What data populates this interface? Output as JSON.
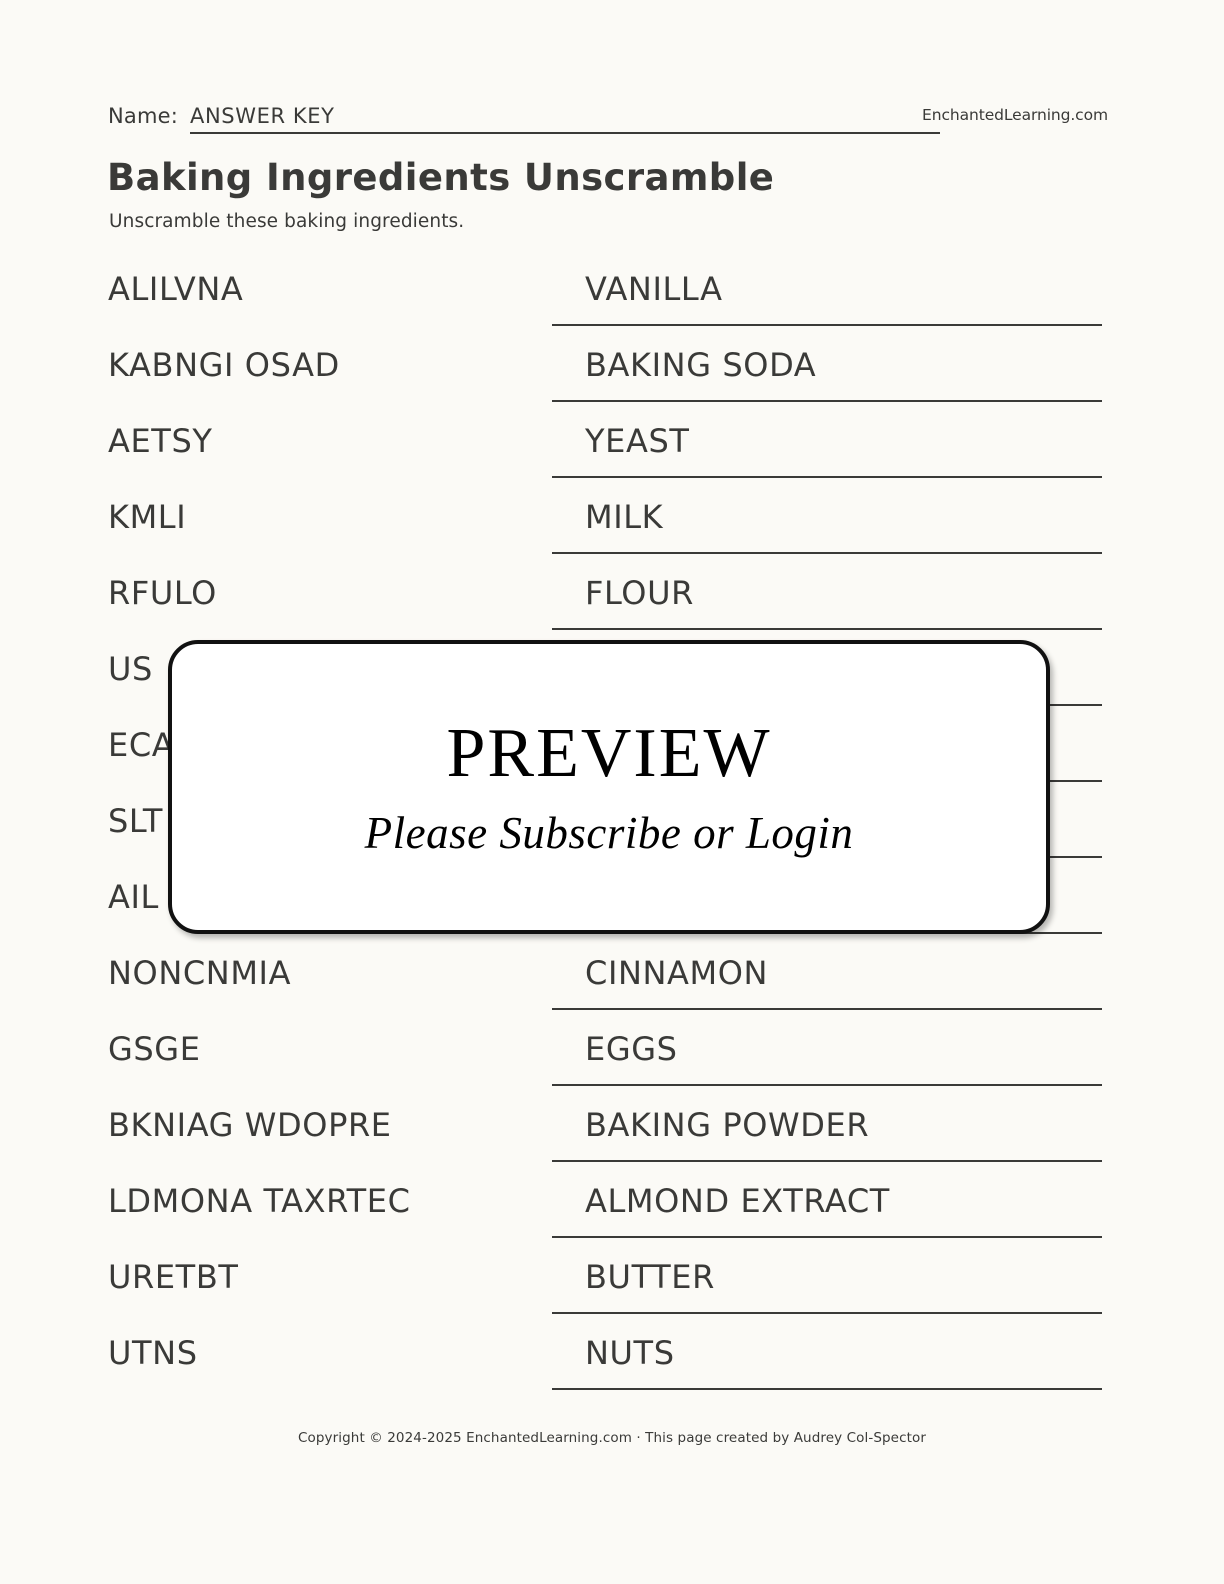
{
  "page": {
    "background_color": "#fbfaf6",
    "text_color": "#3a3a38"
  },
  "header": {
    "name_label": "Name:",
    "name_value": "ANSWER KEY",
    "site_logo": "EnchantedLearning.com"
  },
  "title": "Baking Ingredients Unscramble",
  "instructions": "Unscramble these baking ingredients.",
  "rows": [
    {
      "scrambled": "ALILVNA",
      "answer": "VANILLA",
      "occluded": false
    },
    {
      "scrambled": "KABNGI OSAD",
      "answer": "BAKING SODA",
      "occluded": false
    },
    {
      "scrambled": "AETSY",
      "answer": "YEAST",
      "occluded": false
    },
    {
      "scrambled": "KMLI",
      "answer": "MILK",
      "occluded": false
    },
    {
      "scrambled": "RFULO",
      "answer": "FLOUR",
      "occluded": false
    },
    {
      "scrambled": "US",
      "answer": "",
      "occluded": true
    },
    {
      "scrambled": "ECA",
      "answer": "",
      "occluded": true
    },
    {
      "scrambled": "SLT",
      "answer": "",
      "occluded": true
    },
    {
      "scrambled": "AIL",
      "answer": "",
      "occluded": true
    },
    {
      "scrambled": "NONCNMIA",
      "answer": "CINNAMON",
      "occluded": false
    },
    {
      "scrambled": "GSGE",
      "answer": "EGGS",
      "occluded": false
    },
    {
      "scrambled": "BKNIAG WDOPRE",
      "answer": "BAKING POWDER",
      "occluded": false
    },
    {
      "scrambled": "LDMONA TAXRTEC",
      "answer": "ALMOND EXTRACT",
      "occluded": false
    },
    {
      "scrambled": "URETBT",
      "answer": "BUTTER",
      "occluded": false
    },
    {
      "scrambled": "UTNS",
      "answer": "NUTS",
      "occluded": false
    }
  ],
  "preview_overlay": {
    "title": "PREVIEW",
    "subtitle": "Please Subscribe or Login"
  },
  "footer": {
    "text": "Copyright © 2024-2025 EnchantedLearning.com · This page created by Audrey Col-Spector"
  }
}
